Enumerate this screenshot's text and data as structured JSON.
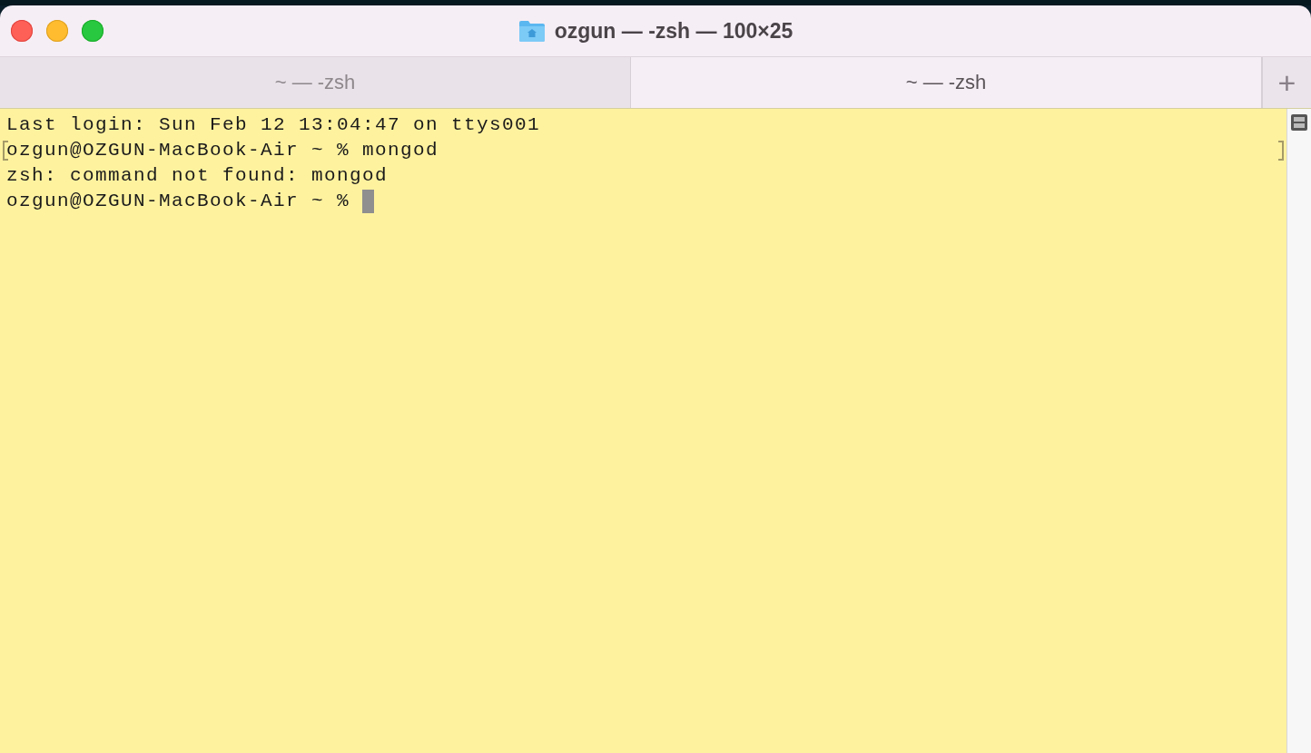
{
  "window": {
    "title": "ozgun — -zsh — 100×25"
  },
  "tabs": [
    {
      "label": "~ — -zsh",
      "selected": false
    },
    {
      "label": "~ — -zsh",
      "selected": true
    }
  ],
  "new_tab_button": {
    "label": "+"
  },
  "terminal": {
    "lines": [
      {
        "text": "Last login: Sun Feb 12 13:04:47 on ttys001",
        "marked": false
      },
      {
        "text": "ozgun@OZGUN-MacBook-Air ~ % mongod",
        "marked": true
      },
      {
        "text": "zsh: command not found: mongod",
        "marked": false
      },
      {
        "text": "ozgun@OZGUN-MacBook-Air ~ % ",
        "marked": false
      }
    ],
    "cursor": true
  }
}
